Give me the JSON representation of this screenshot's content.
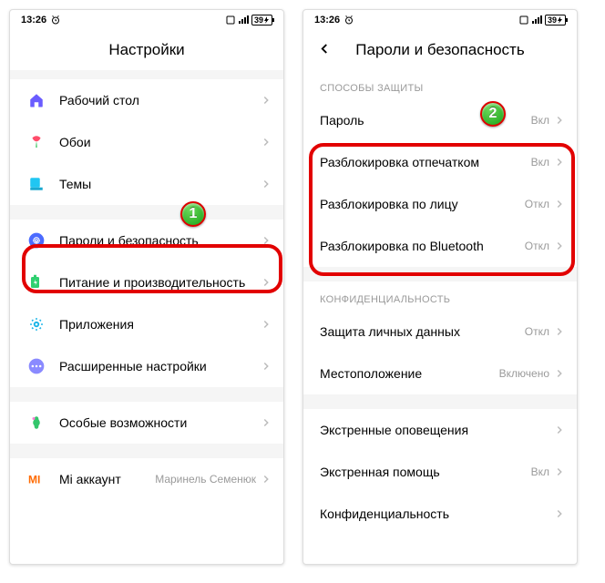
{
  "status": {
    "time": "13:26",
    "battery": "39"
  },
  "annotations": {
    "badge1": "1",
    "badge2": "2"
  },
  "left": {
    "title": "Настройки",
    "rows": [
      {
        "id": "home",
        "label": "Рабочий стол",
        "value": ""
      },
      {
        "id": "wallpaper",
        "label": "Обои",
        "value": ""
      },
      {
        "id": "themes",
        "label": "Темы",
        "value": ""
      },
      {
        "id": "security",
        "label": "Пароли и безопасность",
        "value": ""
      },
      {
        "id": "battery",
        "label": "Питание и производительность",
        "value": ""
      },
      {
        "id": "apps",
        "label": "Приложения",
        "value": ""
      },
      {
        "id": "additional",
        "label": "Расширенные настройки",
        "value": ""
      },
      {
        "id": "accessibility",
        "label": "Особые возможности",
        "value": ""
      },
      {
        "id": "mi",
        "label": "Mi аккаунт",
        "value": "Маринель Семенюк"
      }
    ]
  },
  "right": {
    "title": "Пароли и безопасность",
    "section1": "СПОСОБЫ ЗАЩИТЫ",
    "section2": "КОНФИДЕНЦИАЛЬНОСТЬ",
    "rows1": [
      {
        "id": "password",
        "label": "Пароль",
        "value": "Вкл"
      },
      {
        "id": "fingerprint",
        "label": "Разблокировка отпечатком",
        "value": "Вкл"
      },
      {
        "id": "face",
        "label": "Разблокировка по лицу",
        "value": "Откл"
      },
      {
        "id": "bluetooth",
        "label": "Разблокировка по Bluetooth",
        "value": "Откл"
      }
    ],
    "rows2": [
      {
        "id": "privacy",
        "label": "Защита личных данных",
        "value": "Откл"
      },
      {
        "id": "location",
        "label": "Местоположение",
        "value": "Включено"
      }
    ],
    "rows3": [
      {
        "id": "emergency-alerts",
        "label": "Экстренные оповещения",
        "value": ""
      },
      {
        "id": "emergency-help",
        "label": "Экстренная помощь",
        "value": "Вкл"
      },
      {
        "id": "confidentiality",
        "label": "Конфиденциальность",
        "value": ""
      }
    ]
  }
}
